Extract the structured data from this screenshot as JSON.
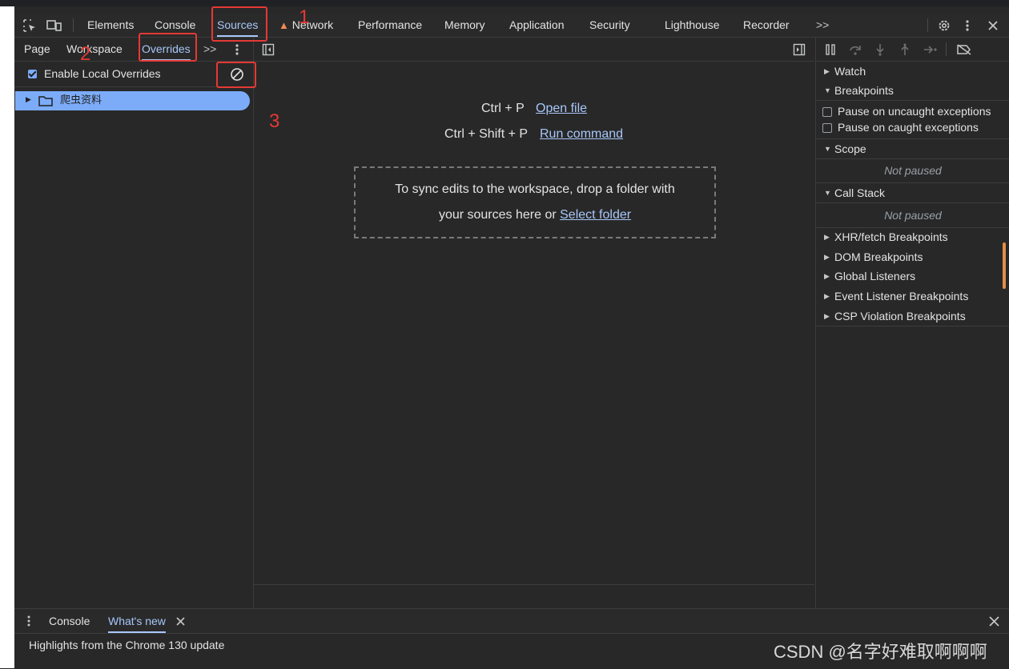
{
  "main_tabs": {
    "elements": "Elements",
    "console": "Console",
    "sources": "Sources",
    "network": "Network",
    "performance": "Performance",
    "memory": "Memory",
    "application": "Application",
    "security": "Security",
    "lighthouse": "Lighthouse",
    "recorder": "Recorder",
    "more": ">>"
  },
  "navigator": {
    "tabs": {
      "page": "Page",
      "workspace": "Workspace",
      "overrides": "Overrides",
      "more": ">>"
    },
    "enable_local_overrides": "Enable Local Overrides",
    "enable_local_overrides_checked": true,
    "tree_folder": "爬虫资料"
  },
  "editor": {
    "shortcut_open": "Ctrl + P",
    "open_file": "Open file",
    "shortcut_run": "Ctrl + Shift + P",
    "run_command": "Run command",
    "drop_text_line1": "To sync edits to the workspace, drop a folder with",
    "drop_text_line2": "your sources here or",
    "select_folder": "Select folder"
  },
  "debugger": {
    "watch": "Watch",
    "breakpoints": "Breakpoints",
    "pause_uncaught": "Pause on uncaught exceptions",
    "pause_caught": "Pause on caught exceptions",
    "scope": "Scope",
    "not_paused_scope": "Not paused",
    "call_stack": "Call Stack",
    "not_paused_stack": "Not paused",
    "xhr": "XHR/fetch Breakpoints",
    "dom": "DOM Breakpoints",
    "global": "Global Listeners",
    "event": "Event Listener Breakpoints",
    "csp": "CSP Violation Breakpoints"
  },
  "drawer": {
    "console_tab": "Console",
    "whats_new_tab": "What's new",
    "highlights": "Highlights from the Chrome 130 update"
  },
  "annotations": {
    "n1": "1",
    "n2": "2",
    "n3": "3"
  },
  "watermark": "CSDN @名字好难取啊啊啊",
  "colors": {
    "accent": "#a8c7fa",
    "annotation": "#e53935",
    "background": "#282828"
  }
}
